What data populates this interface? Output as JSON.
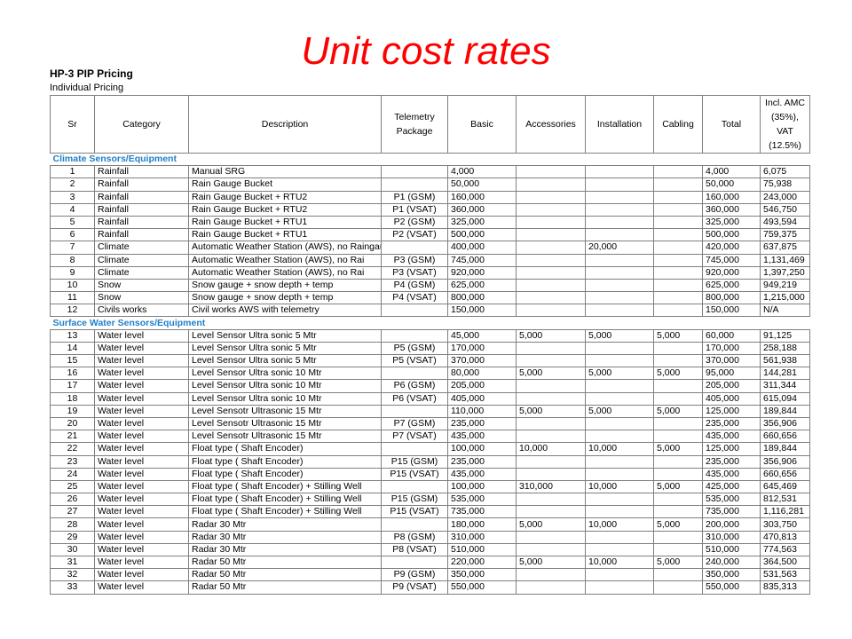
{
  "slide": {
    "title": "Unit cost rates"
  },
  "sheet": {
    "title": "HP-3 PIP Pricing",
    "subtitle": "Individual Pricing"
  },
  "columns": [
    "Sr",
    "Category",
    "Description",
    "Telemetry Package",
    "Basic",
    "Accessories",
    "Installation",
    "Cabling",
    "Total",
    "Incl. AMC (35%), VAT (12.5%)"
  ],
  "sections": [
    {
      "name": "Climate Sensors/Equipment",
      "rows": [
        [
          "1",
          "Rainfall",
          "Manual SRG",
          "",
          "4,000",
          "",
          "",
          "",
          "4,000",
          "6,075"
        ],
        [
          "2",
          "Rainfall",
          "Rain Gauge Bucket",
          "",
          "50,000",
          "",
          "",
          "",
          "50,000",
          "75,938"
        ],
        [
          "3",
          "Rainfall",
          "Rain Gauge Bucket + RTU2",
          "P1 (GSM)",
          "160,000",
          "",
          "",
          "",
          "160,000",
          "243,000"
        ],
        [
          "4",
          "Rainfall",
          "Rain Gauge Bucket + RTU2",
          "P1 (VSAT)",
          "360,000",
          "",
          "",
          "",
          "360,000",
          "546,750"
        ],
        [
          "5",
          "Rainfall",
          "Rain Gauge Bucket + RTU1",
          "P2 (GSM)",
          "325,000",
          "",
          "",
          "",
          "325,000",
          "493,594"
        ],
        [
          "6",
          "Rainfall",
          "Rain Gauge Bucket + RTU1",
          "P2 (VSAT)",
          "500,000",
          "",
          "",
          "",
          "500,000",
          "759,375"
        ],
        [
          "7",
          "Climate",
          "Automatic Weather Station (AWS), no Raingauge",
          "",
          "400,000",
          "",
          "20,000",
          "",
          "420,000",
          "637,875"
        ],
        [
          "8",
          "Climate",
          "Automatic Weather Station (AWS), no Rai",
          "P3 (GSM)",
          "745,000",
          "",
          "",
          "",
          "745,000",
          "1,131,469"
        ],
        [
          "9",
          "Climate",
          "Automatic Weather Station (AWS), no Rai",
          "P3 (VSAT)",
          "920,000",
          "",
          "",
          "",
          "920,000",
          "1,397,250"
        ],
        [
          "10",
          "Snow",
          "Snow gauge + snow depth + temp",
          "P4 (GSM)",
          "625,000",
          "",
          "",
          "",
          "625,000",
          "949,219"
        ],
        [
          "11",
          "Snow",
          "Snow gauge + snow depth + temp",
          "P4 (VSAT)",
          "800,000",
          "",
          "",
          "",
          "800,000",
          "1,215,000"
        ],
        [
          "12",
          "Civils works",
          "Civil works AWS with telemetry",
          "",
          "150,000",
          "",
          "",
          "",
          "150,000",
          "N/A"
        ]
      ]
    },
    {
      "name": "Surface Water Sensors/Equipment",
      "rows": [
        [
          "13",
          "Water level",
          "Level Sensor Ultra sonic 5 Mtr",
          "",
          "45,000",
          "5,000",
          "5,000",
          "5,000",
          "60,000",
          "91,125"
        ],
        [
          "14",
          "Water level",
          "Level Sensor Ultra sonic 5 Mtr",
          "P5 (GSM)",
          "170,000",
          "",
          "",
          "",
          "170,000",
          "258,188"
        ],
        [
          "15",
          "Water level",
          "Level Sensor Ultra sonic 5 Mtr",
          "P5 (VSAT)",
          "370,000",
          "",
          "",
          "",
          "370,000",
          "561,938"
        ],
        [
          "16",
          "Water level",
          "Level Sensor Ultra sonic 10 Mtr",
          "",
          "80,000",
          "5,000",
          "5,000",
          "5,000",
          "95,000",
          "144,281"
        ],
        [
          "17",
          "Water level",
          "Level Sensor Ultra sonic 10 Mtr",
          "P6 (GSM)",
          "205,000",
          "",
          "",
          "",
          "205,000",
          "311,344"
        ],
        [
          "18",
          "Water level",
          "Level Sensor Ultra sonic 10 Mtr",
          "P6 (VSAT)",
          "405,000",
          "",
          "",
          "",
          "405,000",
          "615,094"
        ],
        [
          "19",
          "Water level",
          "Level Sensotr Ultrasonic 15 Mtr",
          "",
          "110,000",
          "5,000",
          "5,000",
          "5,000",
          "125,000",
          "189,844"
        ],
        [
          "20",
          "Water level",
          "Level Sensotr Ultrasonic 15 Mtr",
          "P7 (GSM)",
          "235,000",
          "",
          "",
          "",
          "235,000",
          "356,906"
        ],
        [
          "21",
          "Water level",
          "Level Sensotr Ultrasonic 15 Mtr",
          "P7 (VSAT)",
          "435,000",
          "",
          "",
          "",
          "435,000",
          "660,656"
        ],
        [
          "22",
          "Water level",
          "Float type ( Shaft Encoder)",
          "",
          "100,000",
          "10,000",
          "10,000",
          "5,000",
          "125,000",
          "189,844"
        ],
        [
          "23",
          "Water level",
          "Float type ( Shaft Encoder)",
          "P15 (GSM)",
          "235,000",
          "",
          "",
          "",
          "235,000",
          "356,906"
        ],
        [
          "24",
          "Water level",
          "Float type ( Shaft Encoder)",
          "P15 (VSAT)",
          "435,000",
          "",
          "",
          "",
          "435,000",
          "660,656"
        ],
        [
          "25",
          "Water level",
          "Float type ( Shaft Encoder) + Stilling Well",
          "",
          "100,000",
          "310,000",
          "10,000",
          "5,000",
          "425,000",
          "645,469"
        ],
        [
          "26",
          "Water level",
          "Float type ( Shaft Encoder) + Stilling Well",
          "P15 (GSM)",
          "535,000",
          "",
          "",
          "",
          "535,000",
          "812,531"
        ],
        [
          "27",
          "Water level",
          "Float type ( Shaft Encoder) + Stilling Well",
          "P15 (VSAT)",
          "735,000",
          "",
          "",
          "",
          "735,000",
          "1,116,281"
        ],
        [
          "28",
          "Water level",
          "Radar 30 Mtr",
          "",
          "180,000",
          "5,000",
          "10,000",
          "5,000",
          "200,000",
          "303,750"
        ],
        [
          "29",
          "Water level",
          "Radar 30 Mtr",
          "P8 (GSM)",
          "310,000",
          "",
          "",
          "",
          "310,000",
          "470,813"
        ],
        [
          "30",
          "Water level",
          "Radar 30 Mtr",
          "P8 (VSAT)",
          "510,000",
          "",
          "",
          "",
          "510,000",
          "774,563"
        ],
        [
          "31",
          "Water level",
          "Radar 50 Mtr",
          "",
          "220,000",
          "5,000",
          "10,000",
          "5,000",
          "240,000",
          "364,500"
        ],
        [
          "32",
          "Water level",
          "Radar 50 Mtr",
          "P9 (GSM)",
          "350,000",
          "",
          "",
          "",
          "350,000",
          "531,563"
        ],
        [
          "33",
          "Water level",
          "Radar 50 Mtr",
          "P9 (VSAT)",
          "550,000",
          "",
          "",
          "",
          "550,000",
          "835,313"
        ]
      ]
    }
  ]
}
